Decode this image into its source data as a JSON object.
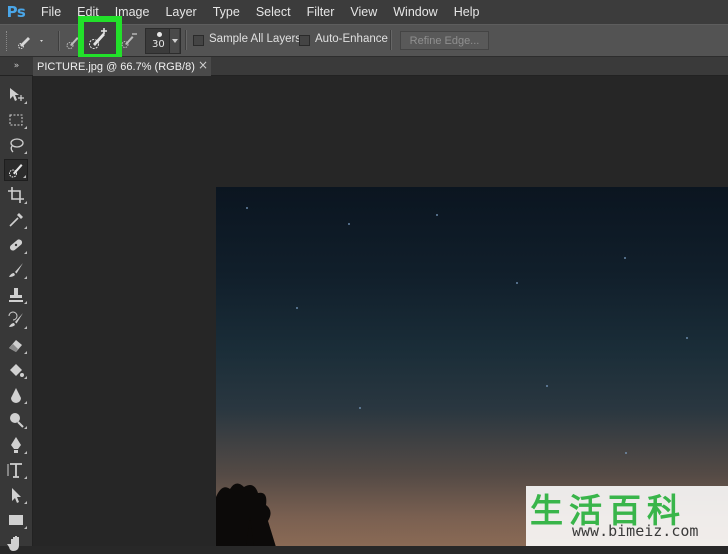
{
  "app": {
    "logo": "Ps"
  },
  "menu": [
    "File",
    "Edit",
    "Image",
    "Layer",
    "Type",
    "Select",
    "Filter",
    "View",
    "Window",
    "Help"
  ],
  "options": {
    "brush_size": "30",
    "sample_all_layers": "Sample All Layers",
    "auto_enhance": "Auto-Enhance",
    "refine_edge": "Refine Edge...",
    "highlight_color": "#22e02a"
  },
  "tab": {
    "title": "PICTURE.jpg @ 66.7% (RGB/8)",
    "close": "×"
  },
  "panel_collapse": "»",
  "tools": [
    "move-tool-icon",
    "marquee-tool-icon",
    "lasso-tool-icon",
    "quick-selection-tool-icon",
    "crop-tool-icon",
    "eyedropper-tool-icon",
    "spot-healing-tool-icon",
    "brush-tool-icon",
    "clone-stamp-tool-icon",
    "history-brush-tool-icon",
    "eraser-tool-icon",
    "paint-bucket-tool-icon",
    "blur-tool-icon",
    "dodge-tool-icon",
    "pen-tool-icon",
    "type-tool-icon",
    "path-selection-tool-icon",
    "shape-tool-icon",
    "hand-tool-icon"
  ],
  "watermark": {
    "title": "生活百科",
    "url": "www.bimeiz.com"
  }
}
